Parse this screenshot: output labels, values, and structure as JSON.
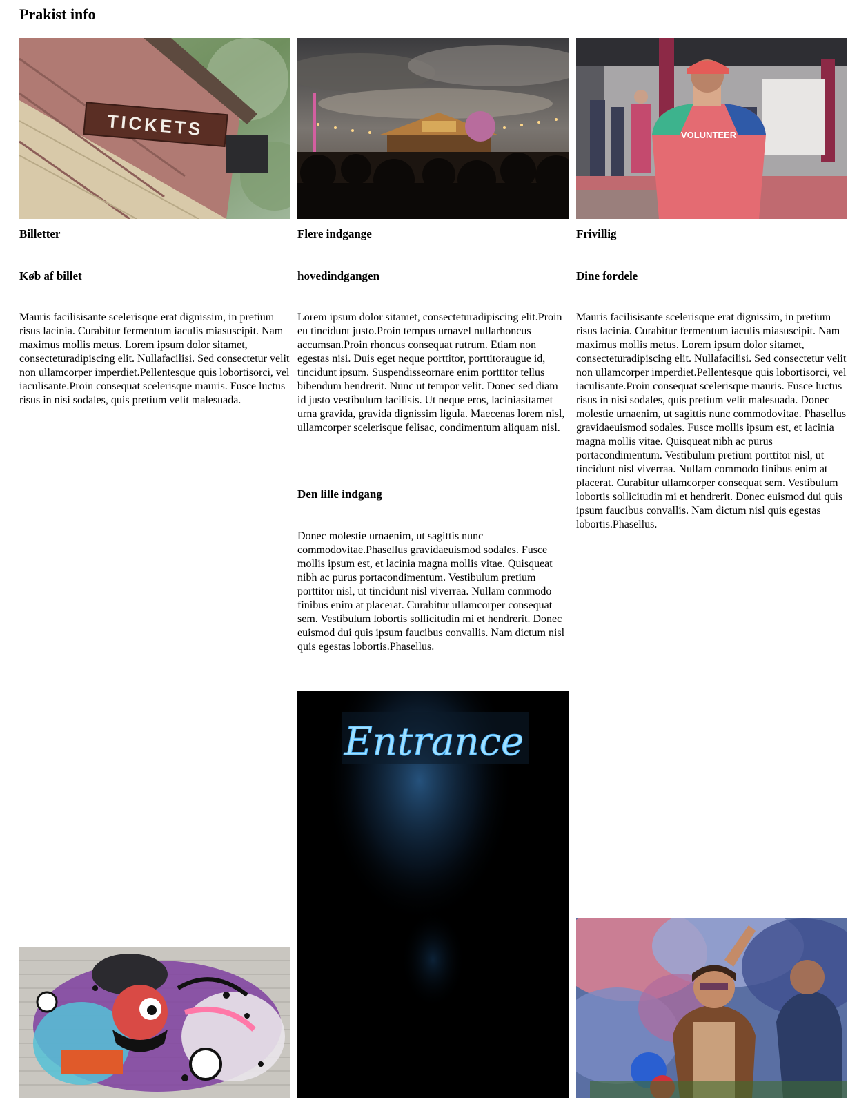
{
  "page": {
    "title": "Prakist info"
  },
  "columns": [
    {
      "heading": "Billetter",
      "subheading": "Køb af billet",
      "paragraph": "Mauris facilisisante scelerisque erat dignissim, in pretium risus lacinia. Curabitur fermentum iaculis miasuscipit. Nam maximus mollis metus. Lorem ipsum dolor sitamet, consecteturadipiscing elit. Nullafacilisi. Sed consectetur velit non ullamcorper imperdiet.Pellentesque quis lobortisorci, vel iaculisante.Proin consequat scelerisque mauris. Fusce luctus risus in nisi sodales, quis pretium velit malesuada.",
      "image_sign_text": "TICKETS"
    },
    {
      "heading": "Flere indgange",
      "subheading": "hovedindgangen",
      "paragraph": "Lorem ipsum dolor sitamet, consecteturadipiscing elit.Proin eu tincidunt justo.Proin tempus urnavel nullarhoncus accumsan.Proin rhoncus consequat rutrum. Etiam non egestas nisi. Duis eget neque porttitor, porttitoraugue id, tincidunt ipsum. Suspendisseornare enim porttitor tellus bibendum hendrerit. Nunc ut tempor velit. Donec sed diam id justo vestibulum facilisis. Ut neque eros, laciniasitamet urna gravida, gravida dignissim ligula. Maecenas lorem nisl, ullamcorper scelerisque felisac, condimentum aliquam nisl.",
      "subheading2": "Den lille indgang",
      "paragraph2": "Donec molestie urnaenim, ut sagittis nunc commodovitae.Phasellus gravidaeuismod sodales. Fusce mollis ipsum est, et lacinia magna mollis vitae. Quisqueat nibh ac purus portacondimentum. Vestibulum pretium porttitor nisl, ut tincidunt nisl viverraa. Nullam commodo finibus enim at placerat. Curabitur ullamcorper consequat sem. Vestibulum lobortis sollicitudin mi et hendrerit. Donec euismod dui quis ipsum faucibus convallis. Nam dictum nisl quis egestas lobortis.Phasellus.",
      "neon_sign_text": "Entrance"
    },
    {
      "heading": "Frivillig",
      "subheading": "Dine fordele",
      "paragraph": "Mauris facilisisante scelerisque erat dignissim, in pretium risus lacinia. Curabitur fermentum iaculis miasuscipit. Nam maximus mollis metus. Lorem ipsum dolor sitamet, consecteturadipiscing elit. Nullafacilisi. Sed consectetur velit non ullamcorper imperdiet.Pellentesque quis lobortisorci, vel iaculisante.Proin consequat scelerisque mauris. Fusce luctus risus in nisi sodales, quis pretium velit malesuada. Donec molestie urnaenim, ut sagittis nunc commodovitae. Phasellus gravidaeuismod sodales. Fusce mollis ipsum est, et lacinia magna mollis vitae. Quisqueat nibh ac purus portacondimentum. Vestibulum pretium porttitor nisl, ut tincidunt nisl viverraa. Nullam commodo finibus enim at placerat. Curabitur ullamcorper consequat sem. Vestibulum lobortis sollicitudin mi et hendrerit. Donec euismod dui quis ipsum faucibus convallis. Nam dictum nisl quis egestas lobortis.Phasellus.",
      "image_shirt_text": "VOLUNTEER"
    }
  ]
}
